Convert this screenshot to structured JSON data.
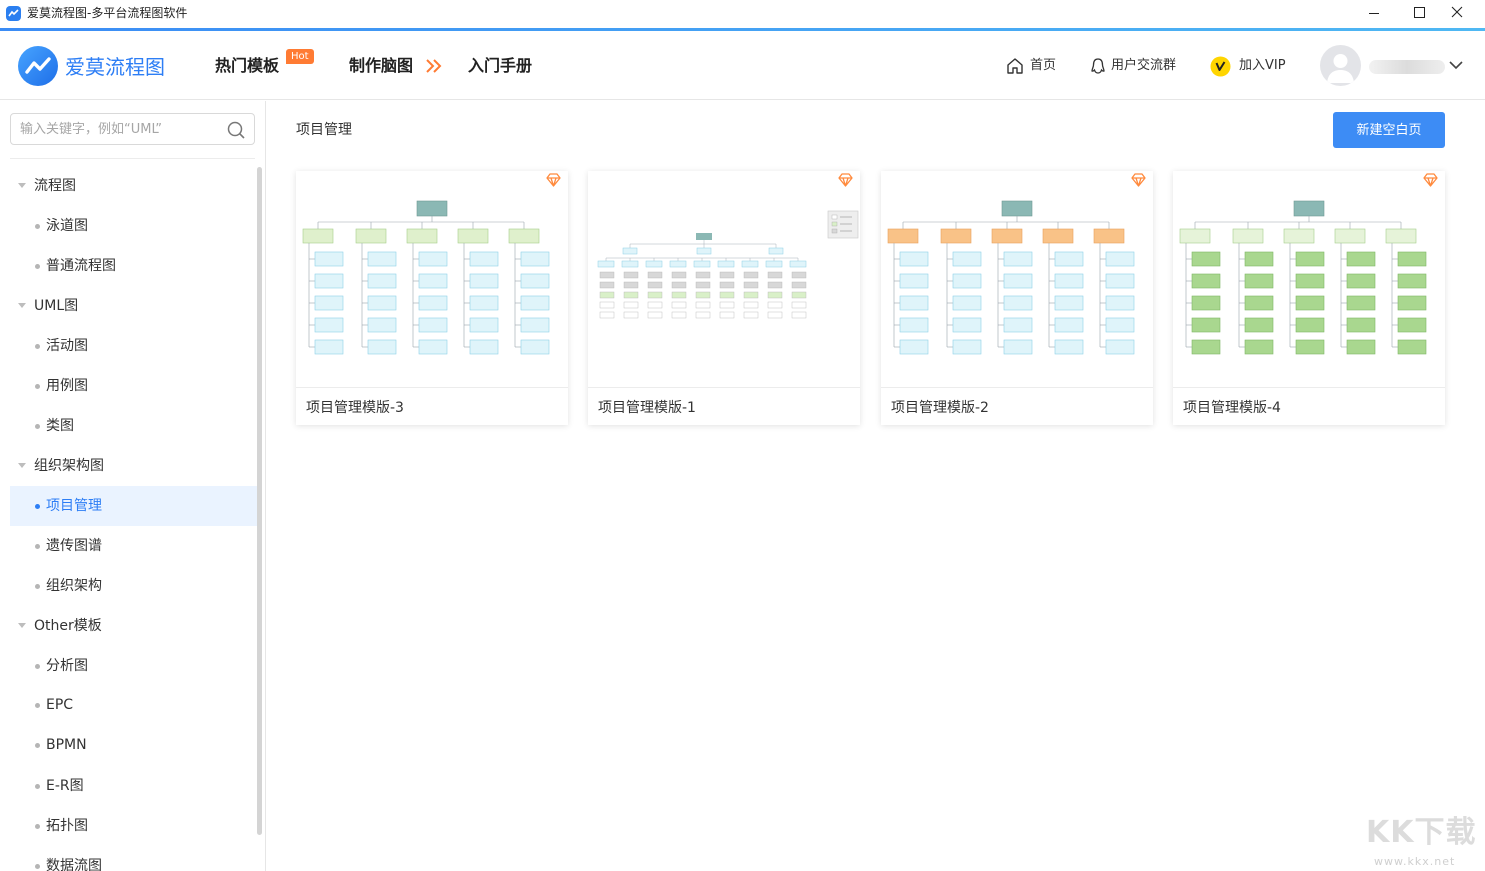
{
  "window": {
    "title": "爱莫流程图-多平台流程图软件"
  },
  "header": {
    "logo_text": "爱莫流程图",
    "nav": {
      "templates": "热门模板",
      "hot_badge": "Hot",
      "mindmap": "制作脑图",
      "manual": "入门手册"
    },
    "right": {
      "home": "首页",
      "community": "用户交流群",
      "vip": "加入VIP"
    }
  },
  "sidebar": {
    "search_placeholder": "输入关键字，例如“UML”",
    "items": [
      {
        "label": "流程图"
      },
      {
        "label": "泳道图"
      },
      {
        "label": "普通流程图"
      },
      {
        "label": "UML图"
      },
      {
        "label": "活动图"
      },
      {
        "label": "用例图"
      },
      {
        "label": "类图"
      },
      {
        "label": "组织架构图"
      },
      {
        "label": "项目管理"
      },
      {
        "label": "遗传图谱"
      },
      {
        "label": "组织架构"
      },
      {
        "label": "Other模板"
      },
      {
        "label": "分析图"
      },
      {
        "label": "EPC"
      },
      {
        "label": "BPMN"
      },
      {
        "label": "E-R图"
      },
      {
        "label": "拓扑图"
      },
      {
        "label": "数据流图"
      }
    ]
  },
  "main": {
    "section_title": "项目管理",
    "new_button": "新建空白页",
    "cards": [
      {
        "caption": "项目管理模版-3"
      },
      {
        "caption": "项目管理模版-1"
      },
      {
        "caption": "项目管理模版-2"
      },
      {
        "caption": "项目管理模版-4"
      }
    ]
  },
  "watermark": {
    "big": "KK下载",
    "small": "www.kkx.net"
  },
  "colors": {
    "accent": "#2d7ef5",
    "hot_badge": "#ff7b33",
    "vip": "#ffd500",
    "selected_bg": "#eaf3ff"
  }
}
